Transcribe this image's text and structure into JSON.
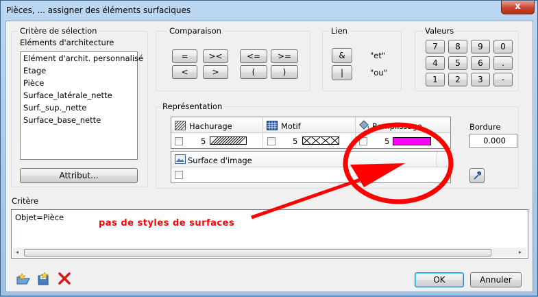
{
  "window": {
    "title": "Pièces, ... assigner des éléments surfaciques",
    "close_label": "x"
  },
  "selection": {
    "group_title": "Critère de sélection",
    "subtitle": "Eléments d'architecture",
    "items": [
      "Elément d'archit. personnalisé",
      "Etage",
      "Pièce",
      "Surface_latérale_nette",
      "Surf._sup._nette",
      "Surface_base_nette"
    ],
    "attribute_button": "Attribut..."
  },
  "comparison": {
    "group_title": "Comparaison",
    "buttons": [
      "=",
      "><",
      "<=",
      ">=",
      "<",
      ">",
      "(",
      ")"
    ]
  },
  "link": {
    "group_title": "Lien",
    "and_button": "&",
    "and_label": "\"et\"",
    "or_button": "|",
    "or_label": "\"ou\""
  },
  "values": {
    "group_title": "Valeurs",
    "keys": [
      "7",
      "8",
      "9",
      "0",
      "4",
      "5",
      "6",
      ".",
      "1",
      "2",
      "3",
      "-"
    ]
  },
  "representation": {
    "group_title": "Représentation",
    "hatching_label": "Hachurage",
    "hatching_value": "5",
    "pattern_label": "Motif",
    "pattern_value": "5",
    "fill_label": "Remplissage",
    "fill_value": "5",
    "fill_color": "#ff00ff",
    "image_label": "Surface d'image",
    "border_label": "Bordure",
    "border_value": "0.000"
  },
  "criteria": {
    "label": "Critère",
    "text": "Objet=Pièce"
  },
  "annotation": {
    "text": "pas de styles de surfaces",
    "color": "#ff0000"
  },
  "footer": {
    "ok_label": "OK",
    "cancel_label": "Annuler"
  }
}
